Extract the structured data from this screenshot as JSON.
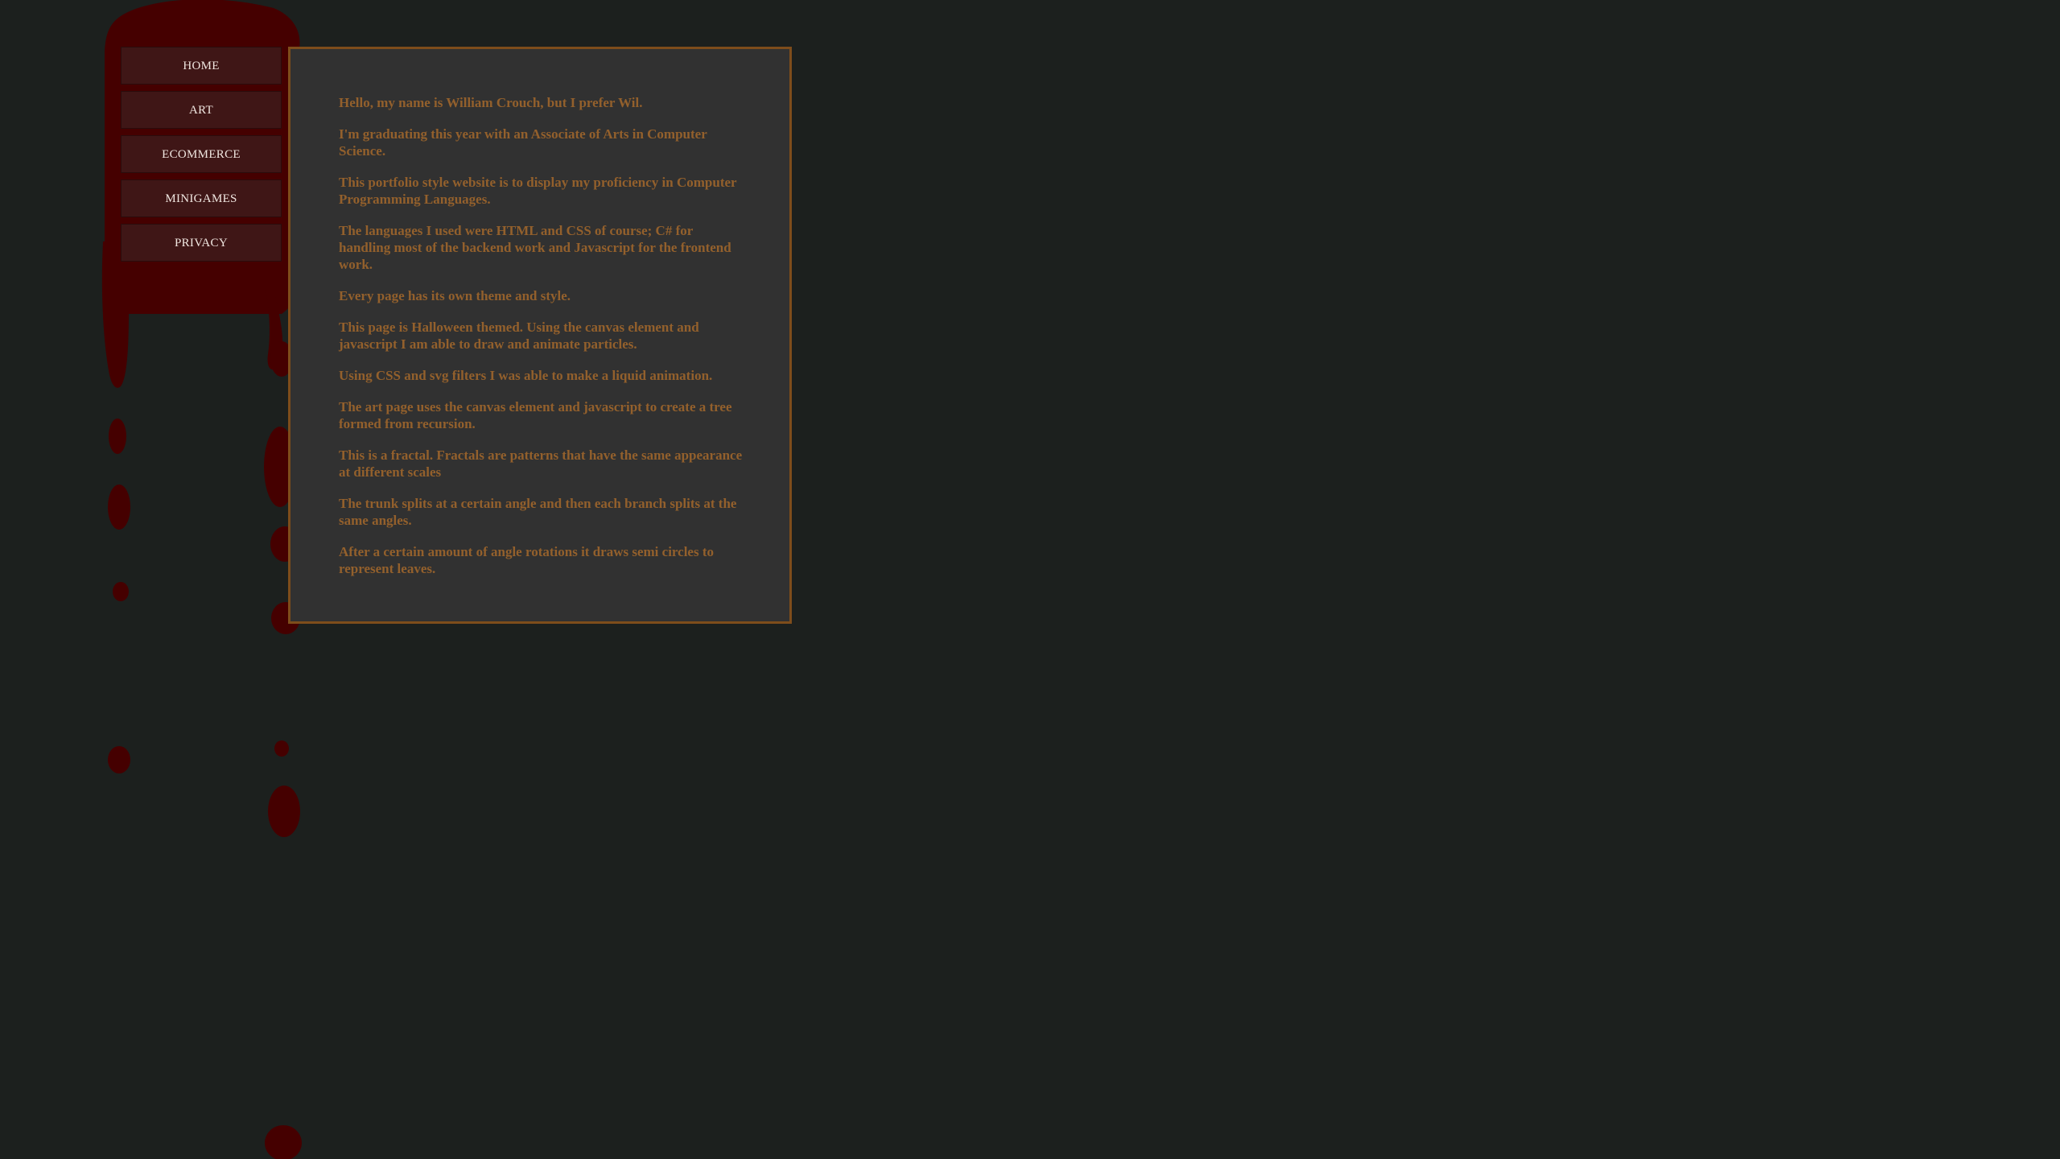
{
  "nav": {
    "items": [
      {
        "label": "HOME"
      },
      {
        "label": "ART"
      },
      {
        "label": "ECOMMERCE"
      },
      {
        "label": "MINIGAMES"
      },
      {
        "label": "PRIVACY"
      }
    ]
  },
  "content": {
    "paragraphs": [
      "Hello, my name is William Crouch, but I prefer Wil.",
      "I'm graduating this year with an Associate of Arts in Computer Science.",
      "This portfolio style website is to display my proficiency in Computer Programming Languages.",
      "The languages I used were HTML and CSS of course; C# for handling most of the backend work and Javascript for the frontend work.",
      "Every page has its own theme and style.",
      "This page is Halloween themed. Using the canvas element and javascript I am able to draw and animate particles.",
      "Using CSS and svg filters I was able to make a liquid animation.",
      "The art page uses the canvas element and javascript to create a tree formed from recursion.",
      "This is a fractal. Fractals are patterns that have the same appearance at different scales",
      "The trunk splits at a certain angle and then each branch splits at the same angles.",
      "After a certain amount of angle rotations it draws semi circles to represent leaves."
    ]
  },
  "colors": {
    "background": "#1c201e",
    "blood": "#450000",
    "nav_button": "#3f1616",
    "panel_background": "#313131",
    "panel_border": "#7e4d1b",
    "text_accent": "#93602c"
  }
}
